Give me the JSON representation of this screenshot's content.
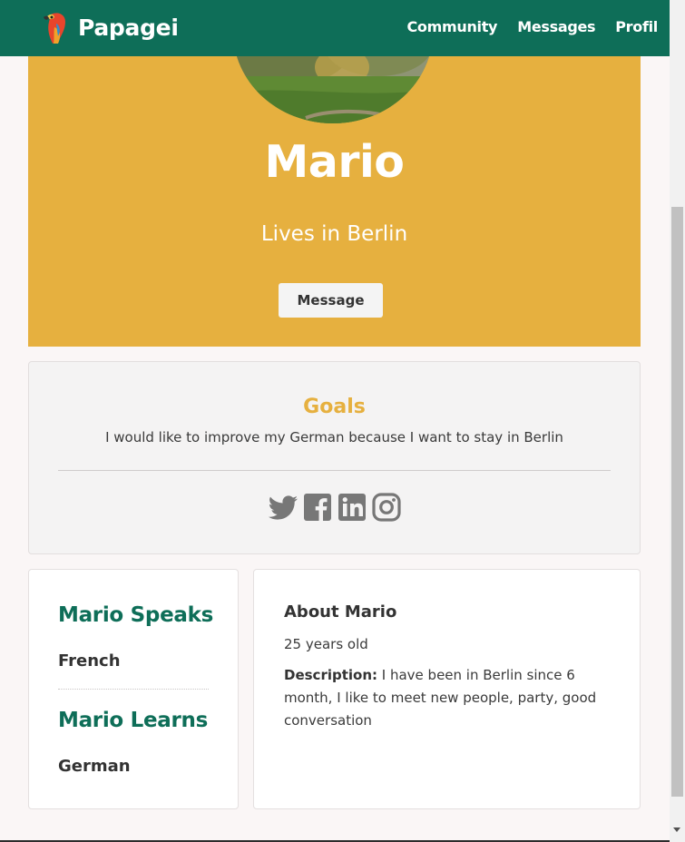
{
  "navbar": {
    "brand": "Papagei",
    "links": [
      "Community",
      "Messages",
      "Profil"
    ],
    "color": "#0e6e58"
  },
  "profile": {
    "name": "Mario",
    "location": "Lives in Berlin",
    "message_button": "Message",
    "accent_color": "#e6b03f"
  },
  "goals": {
    "title": "Goals",
    "text": "I would like to improve my German because I want to stay in Berlin",
    "socials": [
      "twitter-icon",
      "facebook-icon",
      "linkedin-icon",
      "instagram-icon"
    ]
  },
  "languages": {
    "speaks_heading": "Mario Speaks",
    "speaks_value": "French",
    "learns_heading": "Mario Learns",
    "learns_value": "German"
  },
  "about": {
    "title": "About Mario",
    "age": "25 years old",
    "description_label": "Description:",
    "description": " I have been in Berlin since 6 month, I like to meet new people, party, good conversation"
  }
}
